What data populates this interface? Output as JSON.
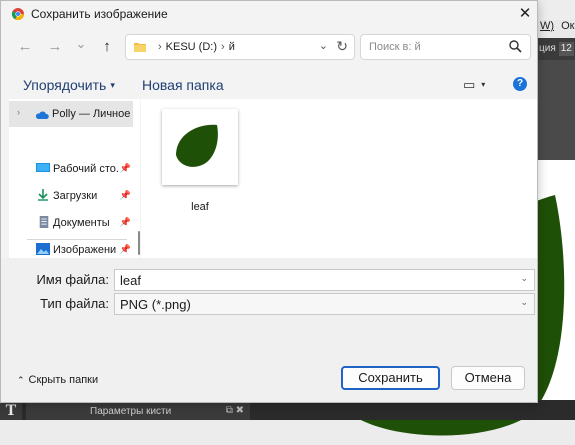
{
  "dialog": {
    "title": "Сохранить изображение",
    "close_glyph": "✕"
  },
  "nav": {
    "back_glyph": "←",
    "forward_glyph": "→",
    "history_glyph": "⌄",
    "up_glyph": "↑",
    "address": {
      "sep_glyph": "›",
      "crumbs": [
        "KESU (D:)",
        "й"
      ],
      "dropdown_glyph": "⌄",
      "refresh_glyph": "↻"
    },
    "search_placeholder": "Поиск в: й"
  },
  "toolbar": {
    "organize_label": "Упорядочить",
    "new_folder_label": "Новая папка",
    "view_glyph": "▭",
    "caret_glyph": "▾",
    "help_glyph": "?"
  },
  "sidebar": {
    "items": [
      {
        "label": "Polly — Личное",
        "icon": "onedrive-cloud-icon"
      },
      {
        "label": "Рабочий сто.",
        "icon": "desktop-icon"
      },
      {
        "label": "Загрузки",
        "icon": "download-icon"
      },
      {
        "label": "Документы",
        "icon": "documents-icon"
      },
      {
        "label": "Изображени",
        "icon": "pictures-icon"
      }
    ],
    "expand_glyph": "›",
    "pin_glyph": "📌"
  },
  "files": [
    {
      "name": "leaf",
      "icon": "leaf-image-thumbnail"
    }
  ],
  "form": {
    "filename_label": "Имя файла:",
    "filename_value": "leaf",
    "filetype_label": "Тип файла:",
    "filetype_value": "PNG (*.png)",
    "chevron_glyph": "⌄"
  },
  "footer": {
    "hide_folders_caret": "⌃",
    "hide_folders_label": "Скрыть папки",
    "save_label": "Сохранить",
    "cancel_label": "Отмена"
  },
  "background_app": {
    "menu_fragment_1": "W)",
    "menu_fragment_2": "Ок",
    "option_label": "ция",
    "option_value": "12",
    "panel_title": "Параметры кисти",
    "panel_icons": "⧉ ✖",
    "tool_glyph": "T"
  },
  "colors": {
    "accent": "#1f63c6",
    "link": "#1f3f73",
    "leaf": "#1f5008",
    "help": "#1a73d9"
  }
}
